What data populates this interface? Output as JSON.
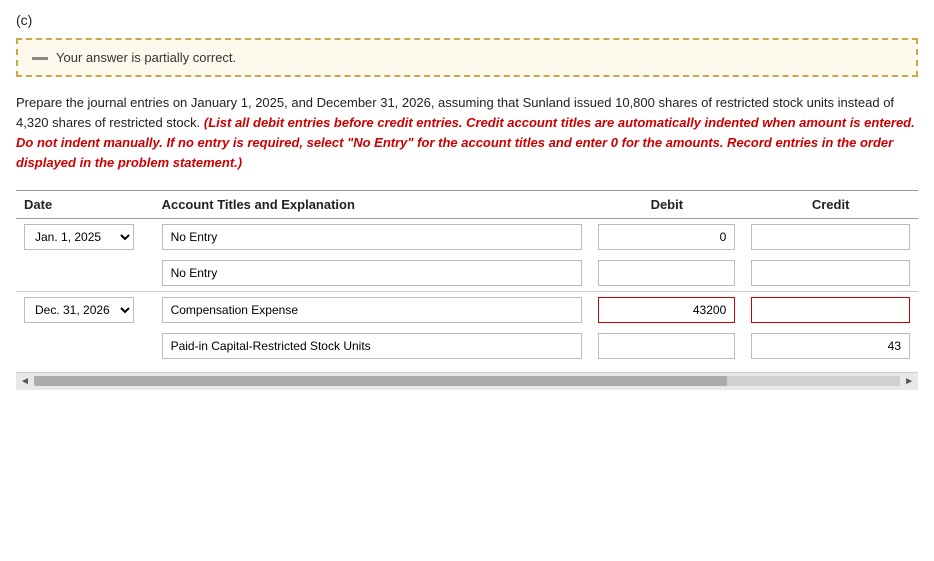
{
  "section_label": "(c)",
  "partial_correct": {
    "icon": "—",
    "text": "Your answer is partially correct."
  },
  "instructions": {
    "main": "Prepare the journal entries on January 1, 2025, and December 31, 2026, assuming that Sunland issued 10,800 shares of restricted stock units instead of 4,320 shares of restricted stock.",
    "red": "(List all debit entries before credit entries. Credit account titles are automatically indented when amount is entered. Do not indent manually. If no entry is required, select \"No Entry\" for the account titles and enter 0 for the amounts. Record entries in the order displayed in the problem statement.)"
  },
  "table": {
    "headers": {
      "date": "Date",
      "account": "Account Titles and Explanation",
      "debit": "Debit",
      "credit": "Credit"
    },
    "rows": [
      {
        "date": "Jan. 1, 2025",
        "account": "No Entry",
        "debit": "0",
        "credit": "",
        "debit_red_border": false,
        "credit_red_border": false,
        "show_date": true
      },
      {
        "date": "",
        "account": "No Entry",
        "debit": "",
        "credit": "",
        "debit_red_border": false,
        "credit_red_border": false,
        "show_date": false
      },
      {
        "date": "Dec. 31, 2026",
        "account": "Compensation Expense",
        "debit": "43200",
        "credit": "",
        "debit_red_border": true,
        "credit_red_border": true,
        "show_date": true
      },
      {
        "date": "",
        "account": "Paid-in Capital-Restricted Stock Units",
        "debit": "",
        "credit": "43",
        "debit_red_border": false,
        "credit_red_border": false,
        "show_date": false
      }
    ]
  },
  "scrollbar": {
    "left_arrow": "◄",
    "right_arrow": "►"
  }
}
